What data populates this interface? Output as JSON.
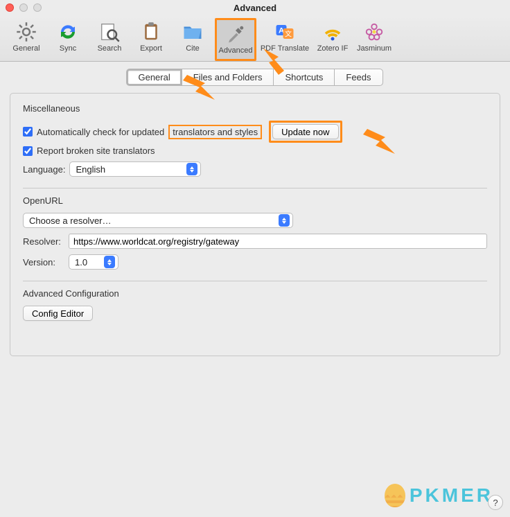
{
  "window": {
    "title": "Advanced"
  },
  "toolbar": {
    "items": [
      {
        "label": "General"
      },
      {
        "label": "Sync"
      },
      {
        "label": "Search"
      },
      {
        "label": "Export"
      },
      {
        "label": "Cite"
      },
      {
        "label": "Advanced"
      },
      {
        "label": "PDF Translate"
      },
      {
        "label": "Zotero IF"
      },
      {
        "label": "Jasminum"
      }
    ]
  },
  "subtabs": {
    "items": [
      "General",
      "Files and Folders",
      "Shortcuts",
      "Feeds"
    ],
    "active": 0
  },
  "misc": {
    "heading": "Miscellaneous",
    "auto_check_prefix": "Automatically check for updated",
    "auto_check_suffix": "translators and styles",
    "update_now": "Update now",
    "report_broken": "Report broken site translators",
    "language_label": "Language:",
    "language_value": "English"
  },
  "openurl": {
    "heading": "OpenURL",
    "choose_resolver": "Choose a resolver…",
    "resolver_label": "Resolver:",
    "resolver_value": "https://www.worldcat.org/registry/gateway",
    "version_label": "Version:",
    "version_value": "1.0"
  },
  "advcfg": {
    "heading": "Advanced Configuration",
    "config_editor": "Config Editor"
  },
  "watermark": "PKMER",
  "help": "?"
}
